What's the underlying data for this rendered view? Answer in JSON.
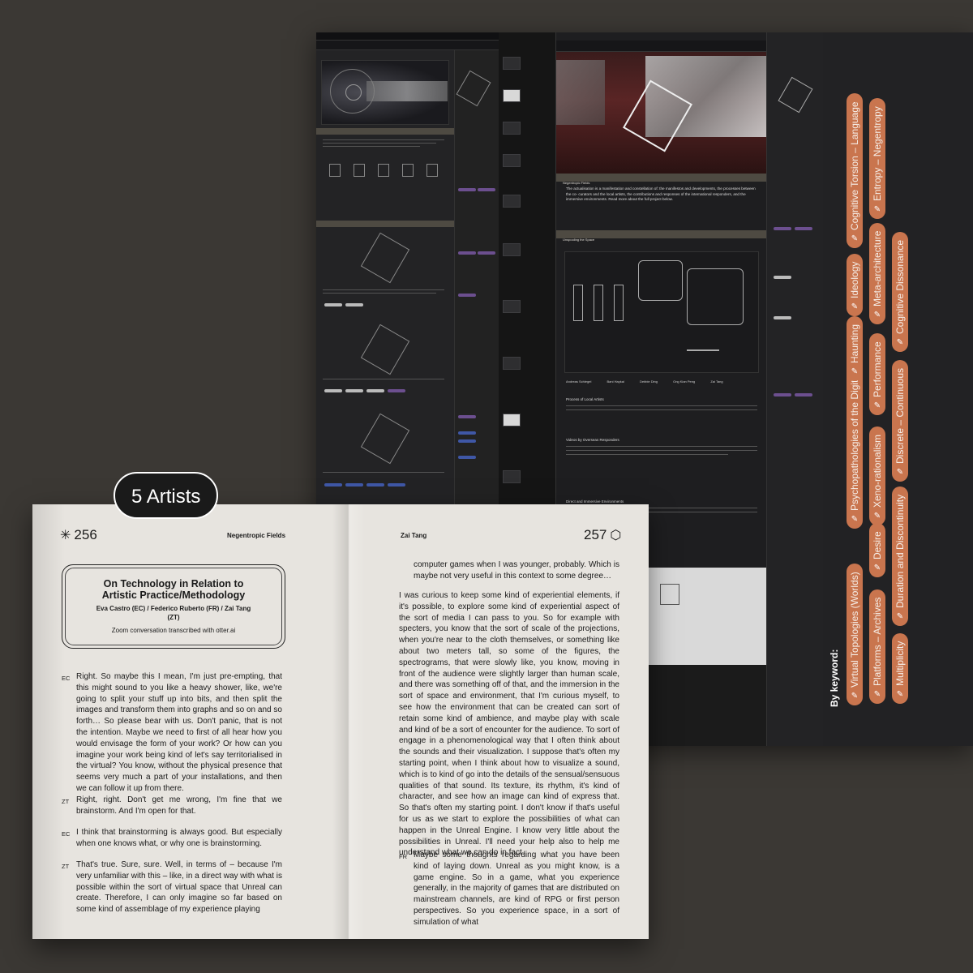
{
  "badge": {
    "label": "5 Artists"
  },
  "keywords": {
    "title": "By keyword:",
    "items": [
      "Virtual Topologies (Worlds)",
      "Platforms – Archives",
      "Multiplicity",
      "Psychopathologies of the Digital",
      "Desire",
      "Duration and Discontinuity",
      "Haunting",
      "Xeno-rationalism",
      "Discrete – Continuous",
      "Ideology",
      "Performance",
      "Cognitive Dissonance",
      "Cognitive Torsion – Language",
      "Meta-architecture",
      "Entropy – Negentropy"
    ]
  },
  "book": {
    "left": {
      "page_number": "256",
      "header": "Negentropic Fields",
      "title": "On Technology in Relation to Artistic Practice/Methodology",
      "authors": "Eva Castro (EC) / Federico Ruberto (FR) / Zai Tang (ZT)",
      "note": "Zoom conversation transcribed with otter.ai",
      "dialogue": [
        {
          "speaker": "EC",
          "text": "Right. So maybe this I mean, I'm just pre-empting, that this might sound to you like a heavy shower, like, we're going to split your stuff up into bits, and then split the images and transform them into graphs and so on and so forth… So please bear with us. Don't panic, that is not the intention. Maybe we need to first of all hear how you would envisage the form of your work? Or how can you imagine your work being kind of let's say territorialised in the virtual? You know, without the physical presence that seems very much a part of your installations, and then we can follow it up from there."
        },
        {
          "speaker": "ZT",
          "text": "Right, right. Don't get me wrong, I'm fine that we brainstorm. And I'm open for that."
        },
        {
          "speaker": "EC",
          "text": "I think that brainstorming is always good. But especially when one knows what, or why one is brainstorming."
        },
        {
          "speaker": "ZT",
          "text": "That's true. Sure, sure. Well, in terms of – because I'm very unfamiliar with this – like, in a direct way with what is possible within the sort of virtual space that Unreal can create. Therefore, I can only imagine so far based on some kind of assemblage of my experience playing"
        }
      ]
    },
    "right": {
      "page_number": "257",
      "header": "Zai Tang",
      "continuation": "computer games when I was younger, probably. Which is maybe not very useful in this context to some degree…",
      "paragraph": "I was curious to keep some kind of experiential elements, if it's possible, to explore some kind of experiential aspect of the sort of media I can pass to you. So for example with specters, you know that the sort of scale of the projections, when you're near to the cloth themselves, or something like about two meters tall, so some of the figures, the spectrograms, that were slowly like, you know, moving in front of the audience were slightly larger than human scale, and there was something off of that, and the immersion in the sort of space and environment, that I'm curious myself, to see how the environment that can be created can sort of retain some kind of ambience, and maybe play with scale and kind of be a sort of encounter for the audience. To sort of engage in a phenomenological way that I often think about the sounds and their visualization. I suppose that's often my starting point, when I think about how to visualize a sound, which is to kind of go into the details of the sensual/sensuous qualities of that sound. Its texture, its rhythm, it's kind of character, and see how an image can kind of express that. So that's often my starting point. I don't know if that's useful for us as we start to explore the possibilities of what can happen in the Unreal Engine. I know very little about the possibilities in Unreal. I'll need your help also to help me understand what we can do in fact.",
      "dialogue": [
        {
          "speaker": "FR",
          "text": "Maybe some thoughts regarding what you have been kind of laying down. Unreal as you might know, is a game engine. So in a game, what you experience generally, in the majority of games that are distributed on mainstream channels, are kind of RPG or first person perspectives. So you experience space, in a sort of simulation of what"
        }
      ]
    }
  },
  "website": {
    "panel_title": "Negentropic Fields",
    "intro": "The actualisation is a manifestation and constellation of: the manifestos and developments, the processes between the co- curators and the local artists, the contributions and responses of the international responders, and the immersive environments. Read more about the full project below.",
    "section_space": "Unspooling the Space",
    "section_local": "Process of Local Artists",
    "section_overseas": "Videos by Overseas Responders",
    "section_direct": "Direct and Immersive Environments",
    "artists": [
      "Andreas Schlegel",
      "Bani Haykal",
      "Debbie Ding",
      "Ong Kian Peng",
      "Zai Tang"
    ]
  },
  "colors": {
    "pill": "#c9754e",
    "page": "#e7e4df",
    "background": "#3b3834",
    "site": "#1d1d1f"
  }
}
